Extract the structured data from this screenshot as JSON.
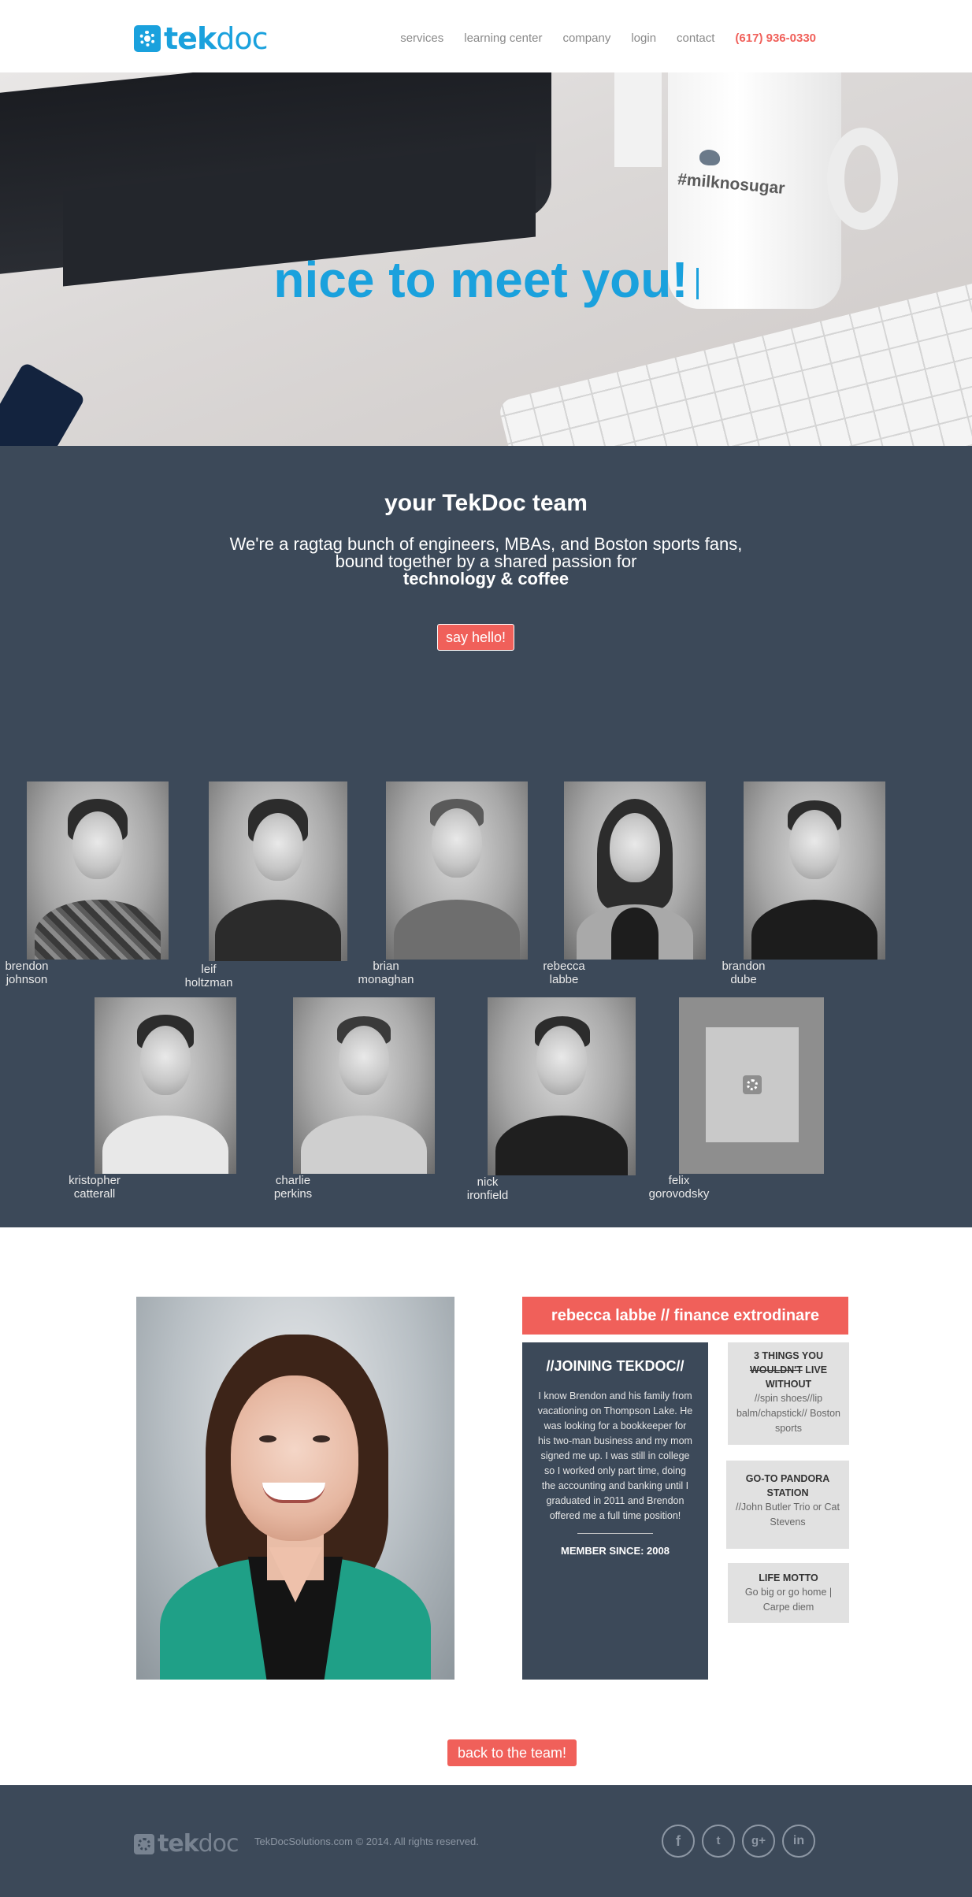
{
  "header": {
    "logo_tek": "tek",
    "logo_doc": "doc",
    "nav": {
      "services": "services",
      "learning_center": "learning center",
      "company": "company",
      "login": "login",
      "contact": "contact",
      "phone": "(617) 936-0330"
    }
  },
  "hero": {
    "title": "nice to meet you!",
    "mug_text": "#milknosugar"
  },
  "team": {
    "title": "your TekDoc team",
    "desc_line1": "We're a ragtag bunch of engineers, MBAs, and Boston sports fans,",
    "desc_line2": "bound together by a shared passion for",
    "desc_line3": "technology & coffee",
    "hello_button": "say hello!",
    "members": [
      {
        "name": "brendon johnson"
      },
      {
        "name": "leif holtzman"
      },
      {
        "name": "brian monaghan"
      },
      {
        "name": "rebecca labbe"
      },
      {
        "name": "brandon dube"
      },
      {
        "name": "kristopher catterall"
      },
      {
        "name": "charlie perkins"
      },
      {
        "name": "nick ironfield"
      },
      {
        "name": "felix gorovodsky"
      }
    ]
  },
  "profile": {
    "role_heading": "rebecca labbe // finance extrodinare",
    "story_title": "//JOINING TEKDOC//",
    "story_text": "I know Brendon and his family from vacationing on Thompson Lake. He was looking for a bookkeeper for his two-man business and my mom signed me up. I was still in college so I worked only part time, doing the accounting and banking until I graduated in 2011 and Brendon offered me a full time position!",
    "member_since": "MEMBER SINCE: 2008",
    "facts": {
      "things_title_a": "3 THINGS YOU",
      "things_title_strike": "WOULDN'T",
      "things_title_b": " LIVE WITHOUT",
      "things_body": "//spin shoes//lip balm/chapstick// Boston sports",
      "pandora_title": "GO-TO PANDORA STATION",
      "pandora_body": "//John Butler Trio or Cat Stevens",
      "motto_title": "LIFE MOTTO",
      "motto_body": "Go big or go home | Carpe diem"
    },
    "back_button": "back to the team!"
  },
  "footer": {
    "logo_tek": "tek",
    "logo_doc": "doc",
    "copyright": "TekDocSolutions.com © 2014. All rights reserved.",
    "social": {
      "facebook": "f",
      "twitter": "t",
      "googleplus": "g+",
      "linkedin": "in"
    }
  },
  "colors": {
    "brand_blue": "#1aa1dd",
    "accent_coral": "#f0605a",
    "slate": "#3c4959"
  }
}
